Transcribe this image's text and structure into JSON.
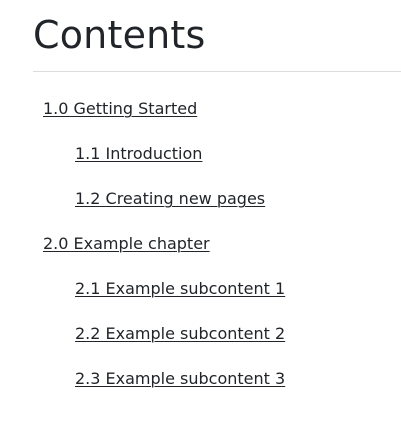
{
  "page": {
    "title": "Contents"
  },
  "toc": {
    "items": [
      {
        "label": "1.0 Getting Started",
        "level": 1
      },
      {
        "label": "1.1 Introduction",
        "level": 2
      },
      {
        "label": "1.2 Creating new pages",
        "level": 2
      },
      {
        "label": "2.0 Example chapter",
        "level": 1
      },
      {
        "label": "2.1 Example subcontent 1",
        "level": 2
      },
      {
        "label": "2.2 Example subcontent 2",
        "level": 2
      },
      {
        "label": "2.3 Example subcontent 3",
        "level": 2
      }
    ]
  }
}
